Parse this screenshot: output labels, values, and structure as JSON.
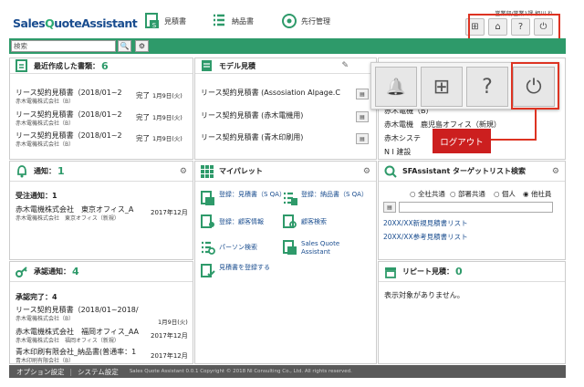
{
  "header": {
    "logo_prefix": "Sales",
    "logo_q": "Q",
    "logo_suffix": "uoteAssistant",
    "nav": [
      {
        "label": "見積書",
        "icon": "document-s-icon"
      },
      {
        "label": "納品書",
        "icon": "delivery-list-icon"
      },
      {
        "label": "先行管理",
        "icon": "target-icon"
      }
    ],
    "user_info": "営業部/営業1課 相川 れ",
    "toolbar_icons": [
      "switch-icon",
      "home-icon",
      "help-icon",
      "power-icon"
    ],
    "toolbar_glyphs": [
      "⊞",
      "⌂",
      "?",
      "⏻"
    ]
  },
  "search": {
    "placeholder": "検索",
    "search_glyph": "🔍",
    "settings_glyph": "⚙"
  },
  "recent": {
    "title": "最近作成した書類：",
    "count": "6",
    "rows": [
      {
        "title": "リース契約見積書（2018/01~2",
        "status": "完了",
        "date": "1月9日(火)",
        "sub": "赤木電機株式会社（B）"
      },
      {
        "title": "リース契約見積書（2018/01~2",
        "status": "完了",
        "date": "1月9日(火)",
        "sub": "赤木電機株式会社（B）"
      },
      {
        "title": "リース契約見積書（2018/01~2",
        "status": "完了",
        "date": "1月9日(火)",
        "sub": "赤木電機株式会社（B）"
      }
    ]
  },
  "model": {
    "title": "モデル見積",
    "rows": [
      "リース契約見積書 (Assosiation Alpage.C",
      "リース契約見積書 (赤木電機用)",
      "リース契約見積書 (青木印刷用)"
    ]
  },
  "right_top": {
    "rows": [
      "赤木電機（B）",
      "赤木電機　鹿児島オフィス（新規）",
      "赤木システ",
      "N I 建設"
    ]
  },
  "popup": {
    "buttons": [
      "bell-icon",
      "switch-icon",
      "help-icon",
      "power-icon"
    ],
    "glyphs": [
      "🔔",
      "⊞",
      "?",
      "⏻"
    ],
    "logout_label": "ログアウト"
  },
  "notify": {
    "title": "通知：",
    "count": "1",
    "heading": "受注通知：1",
    "item_title": "赤木電機株式会社　東京オフィス_A",
    "item_sub": "赤木電機株式会社　東京オフィス（新規）",
    "item_date": "2017年12月"
  },
  "mypallet": {
    "title": "マイパレット",
    "items": [
      {
        "label": "登録：見積書（S QA）",
        "icon": "doc-s-icon"
      },
      {
        "label": "登録：納品書（S QA）",
        "icon": "list-s-icon"
      },
      {
        "label": "登録：顧客情報",
        "icon": "customer-icon"
      },
      {
        "label": "顧客検索",
        "icon": "customer-search-icon"
      },
      {
        "label": "パーソン検索",
        "icon": "person-search-icon"
      },
      {
        "label": "Sales Quote Assistant",
        "icon": "sqa-icon"
      },
      {
        "label": "見積書を登録する",
        "icon": "list-check-icon"
      }
    ]
  },
  "sfa": {
    "title": "SFAssistant ターゲットリスト検索",
    "radios": [
      "全社共通",
      "部署共通",
      "個人",
      "他社員"
    ],
    "selected": "他社員",
    "links": [
      "20XX/XX新規見積書リスト",
      "20XX/XX参考見積書リスト"
    ]
  },
  "approval": {
    "title": "承認通知：",
    "count": "4",
    "heading": "承認完了：4",
    "rows": [
      {
        "title": "リース契約見積書（2018/01~2018/",
        "sub": "赤木電機株式会社（B）",
        "date": "1月9日(火)"
      },
      {
        "title": "赤木電機株式会社　福岡オフィス_AA",
        "sub": "赤木電機株式会社　福岡オフィス（新規）",
        "date": "2017年12月"
      },
      {
        "title": "青木印刷有限会社_納品書(普通率：1",
        "sub": "青木印刷有限会社（B）",
        "date": "2017年12月"
      }
    ]
  },
  "repeat": {
    "title": "リピート見積：",
    "count": "0",
    "empty": "表示対象がありません。"
  },
  "footer": {
    "option": "オプション設定",
    "sep": "|",
    "system": "システム設定",
    "copyright": "Sales Quote Assistant 0.0.1 Copyright © 2018 NI Consulting Co., Ltd. All rights reserved."
  },
  "colors": {
    "brand": "#1a4d8f",
    "accent": "#2e9a6a",
    "highlight": "#cc1f1f"
  }
}
